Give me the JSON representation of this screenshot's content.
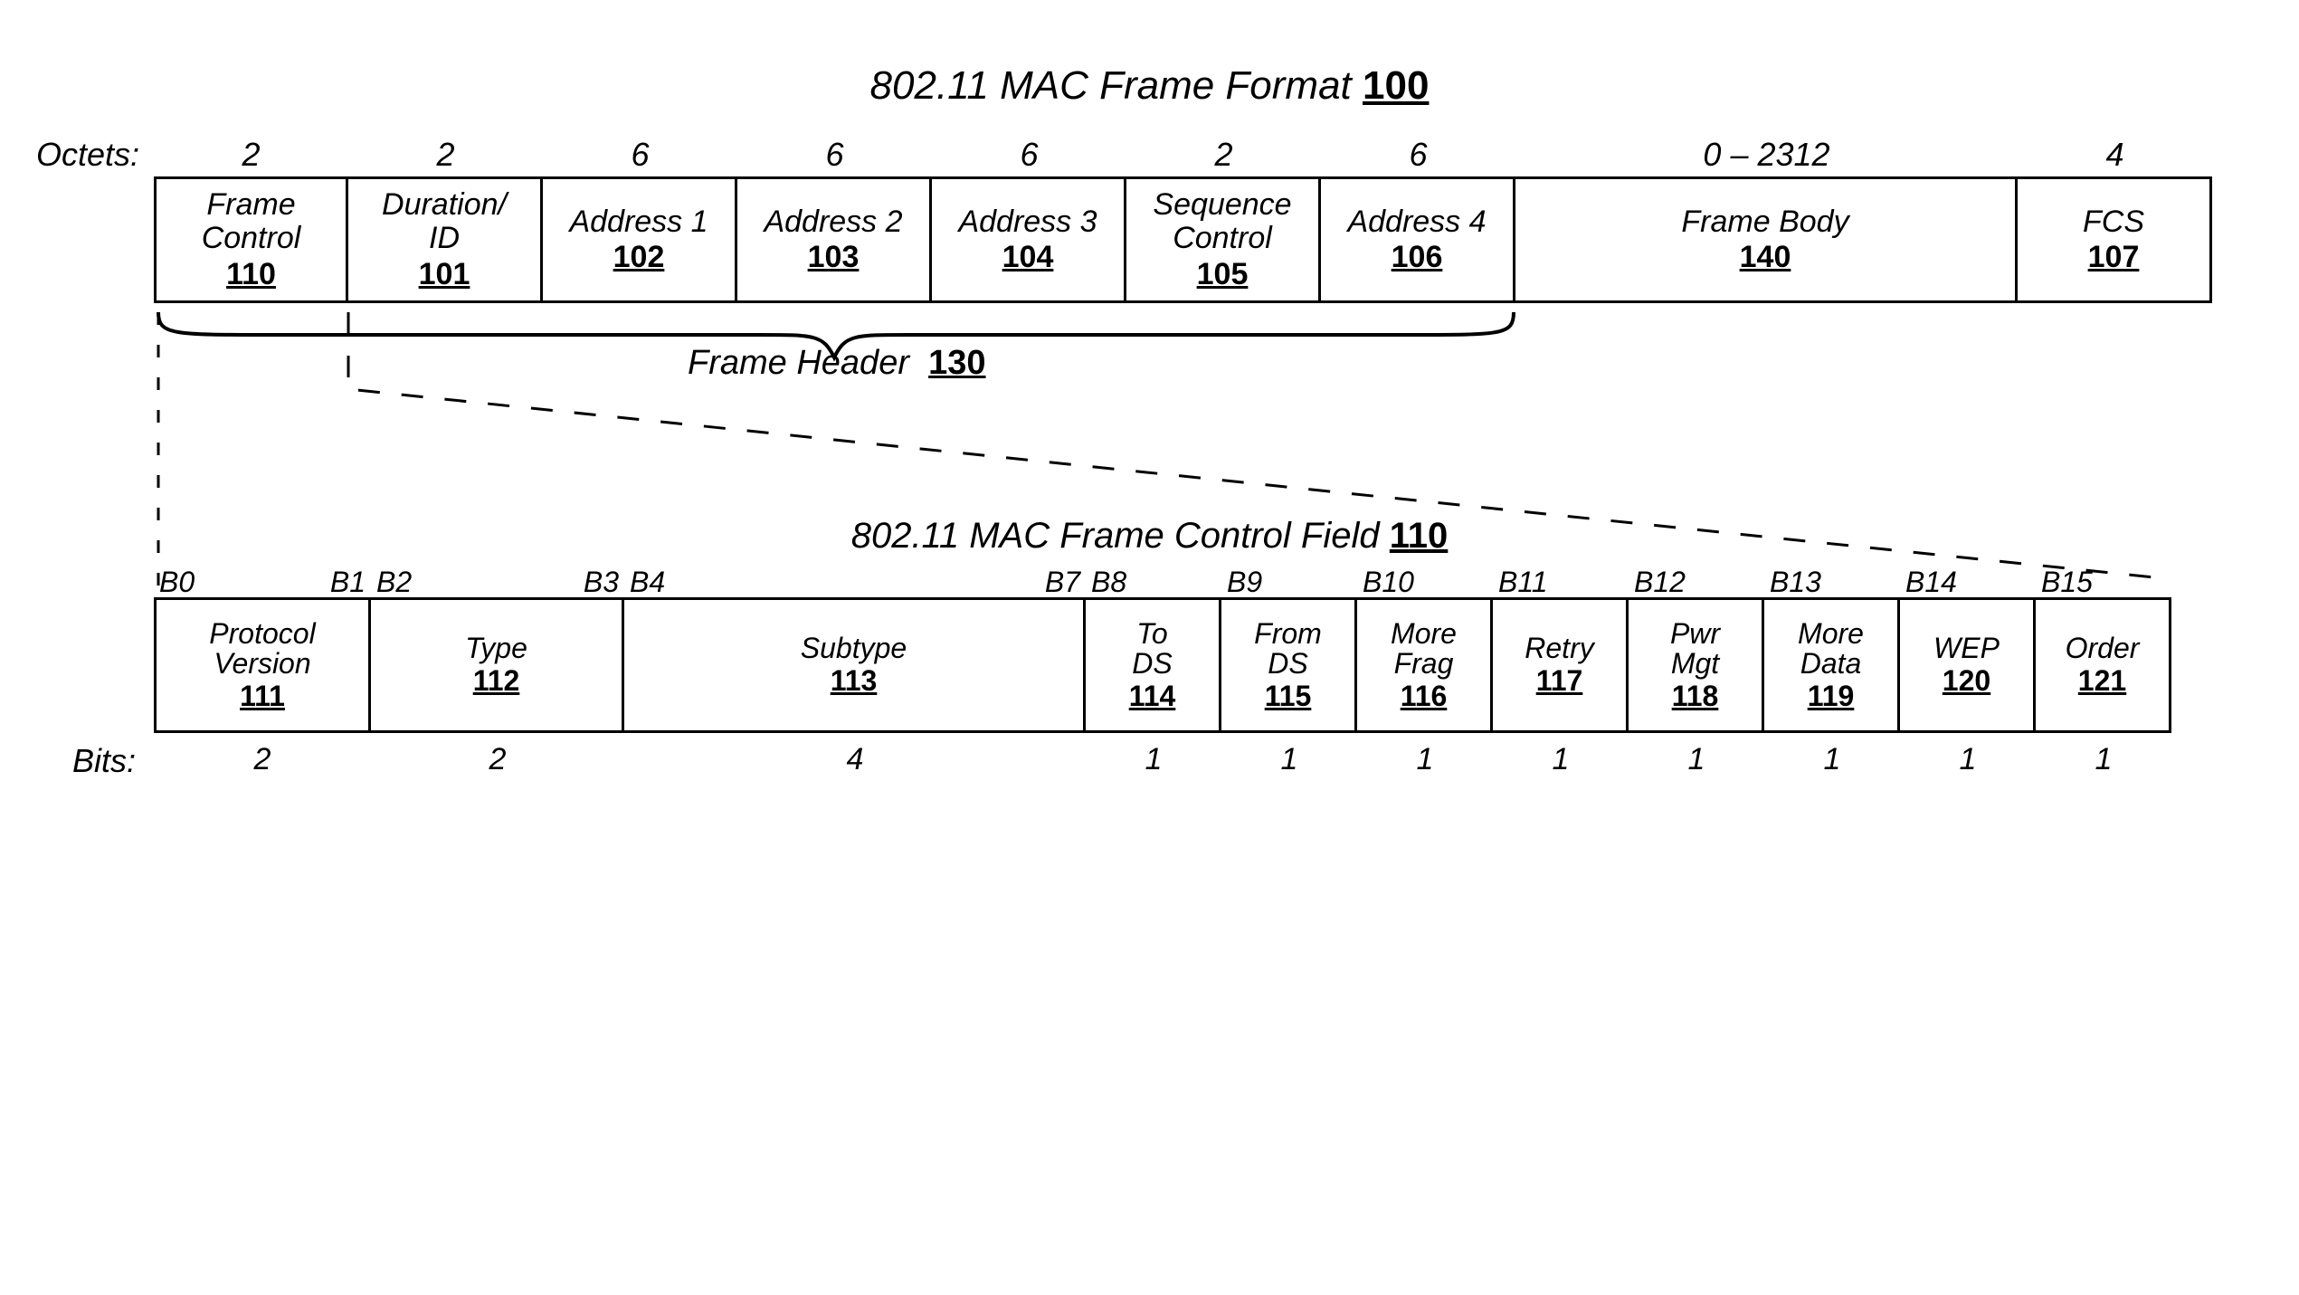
{
  "title": {
    "text": "802.11 MAC Frame Format",
    "ref": "100"
  },
  "octets_label": "Octets:",
  "top": {
    "fields": [
      {
        "label": "Frame\nControl",
        "ref": "110",
        "octets": "2",
        "wclass": "w-small"
      },
      {
        "label": "Duration/\nID",
        "ref": "101",
        "octets": "2",
        "wclass": "w-small"
      },
      {
        "label": "Address 1",
        "ref": "102",
        "octets": "6",
        "wclass": "w-small"
      },
      {
        "label": "Address 2",
        "ref": "103",
        "octets": "6",
        "wclass": "w-small"
      },
      {
        "label": "Address 3",
        "ref": "104",
        "octets": "6",
        "wclass": "w-small"
      },
      {
        "label": "Sequence\nControl",
        "ref": "105",
        "octets": "2",
        "wclass": "w-small"
      },
      {
        "label": "Address 4",
        "ref": "106",
        "octets": "6",
        "wclass": "w-small"
      },
      {
        "label": "Frame Body",
        "ref": "140",
        "octets": "0 – 2312",
        "wclass": "w-body"
      },
      {
        "label": "FCS",
        "ref": "107",
        "octets": "4",
        "wclass": "w-fcs"
      }
    ]
  },
  "header_label": {
    "text": "Frame Header",
    "ref": "130"
  },
  "subtitle": {
    "text": "802.11 MAC Frame Control Field",
    "ref": "110"
  },
  "bottom": {
    "fields": [
      {
        "label": "Protocol\nVersion",
        "ref": "111",
        "bits": "2",
        "wclass": "bw-pv",
        "bit_left": "B0",
        "bit_right": "B1"
      },
      {
        "label": "Type",
        "ref": "112",
        "bits": "2",
        "wclass": "bw-type",
        "bit_left": "B2",
        "bit_right": "B3"
      },
      {
        "label": "Subtype",
        "ref": "113",
        "bits": "4",
        "wclass": "bw-sub",
        "bit_left": "B4",
        "bit_right": "B7"
      },
      {
        "label": "To\nDS",
        "ref": "114",
        "bits": "1",
        "wclass": "bw-1",
        "bit_left": "B8",
        "bit_right": ""
      },
      {
        "label": "From\nDS",
        "ref": "115",
        "bits": "1",
        "wclass": "bw-1",
        "bit_left": "B9",
        "bit_right": ""
      },
      {
        "label": "More\nFrag",
        "ref": "116",
        "bits": "1",
        "wclass": "bw-1",
        "bit_left": "B10",
        "bit_right": ""
      },
      {
        "label": "Retry",
        "ref": "117",
        "bits": "1",
        "wclass": "bw-1",
        "bit_left": "B11",
        "bit_right": ""
      },
      {
        "label": "Pwr\nMgt",
        "ref": "118",
        "bits": "1",
        "wclass": "bw-1",
        "bit_left": "B12",
        "bit_right": ""
      },
      {
        "label": "More\nData",
        "ref": "119",
        "bits": "1",
        "wclass": "bw-1",
        "bit_left": "B13",
        "bit_right": ""
      },
      {
        "label": "WEP",
        "ref": "120",
        "bits": "1",
        "wclass": "bw-1",
        "bit_left": "B14",
        "bit_right": ""
      },
      {
        "label": "Order",
        "ref": "121",
        "bits": "1",
        "wclass": "bw-1",
        "bit_left": "B15",
        "bit_right": ""
      }
    ]
  },
  "bits_label": "Bits:"
}
